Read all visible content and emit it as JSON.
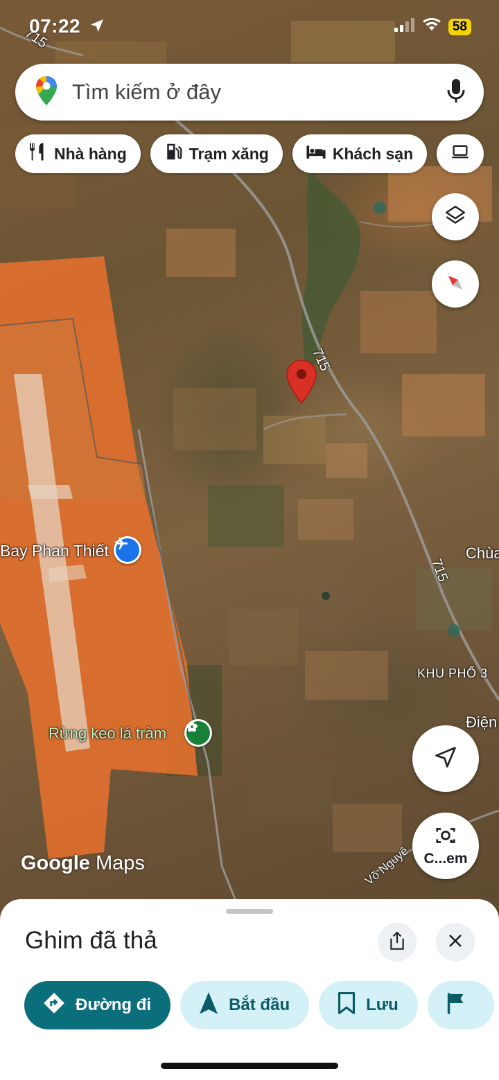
{
  "status": {
    "time": "07:22",
    "battery": "58"
  },
  "search": {
    "placeholder": "Tìm kiếm ở đây"
  },
  "chips": [
    {
      "label": "Nhà hàng",
      "icon": "restaurant-icon"
    },
    {
      "label": "Trạm xăng",
      "icon": "gas-station-icon"
    },
    {
      "label": "Khách sạn",
      "icon": "hotel-icon"
    }
  ],
  "map": {
    "road_labels": [
      "715",
      "715",
      "715"
    ],
    "place_labels": {
      "airport": "Bay Phan Thiết",
      "forest": "Rừng keo lá tràm",
      "chua": "Chùa",
      "khu_pho": "KHU PHỐ 3",
      "dien": "Điện",
      "street": "Võ Nguyê"
    },
    "google_logo": {
      "google": "Google",
      "maps": "Maps"
    },
    "camera_button_label": "C...em"
  },
  "sheet": {
    "title": "Ghim đã thả",
    "actions": [
      {
        "label": "Đường đi"
      },
      {
        "label": "Bắt đầu"
      },
      {
        "label": "Lưu"
      }
    ]
  },
  "colors": {
    "accent": "#0b6e7b",
    "accent_light": "#d3f1f6",
    "pin": "#d93025",
    "airport_zone": "#e2702e"
  }
}
